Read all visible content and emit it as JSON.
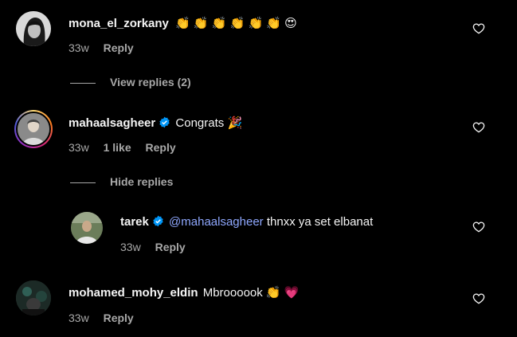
{
  "comments": [
    {
      "username": "mona_el_zorkany",
      "text": "👏 👏 👏 👏 👏 👏 😍",
      "time": "33w",
      "reply_label": "Reply",
      "view_replies": "View replies (2)"
    },
    {
      "username": "mahaalsagheer",
      "verified": true,
      "text": "Congrats 🎉",
      "time": "33w",
      "likes": "1 like",
      "reply_label": "Reply",
      "hide_replies": "Hide replies",
      "reply": {
        "username": "tarek",
        "verified": true,
        "mention": "@mahaalsagheer",
        "text": " thnxx ya set elbanat",
        "time": "33w",
        "reply_label": "Reply"
      }
    },
    {
      "username": "mohamed_mohy_eldin",
      "text": "Mbroooook 👏 💗",
      "time": "33w",
      "reply_label": "Reply"
    }
  ],
  "colors": {
    "background": "#000000",
    "text": "#f5f5f5",
    "secondary": "#a8a8a8",
    "mention": "#8fa8ff",
    "verified": "#0095f6"
  },
  "icons": [
    "heart-outline-icon",
    "verified-badge-icon"
  ]
}
